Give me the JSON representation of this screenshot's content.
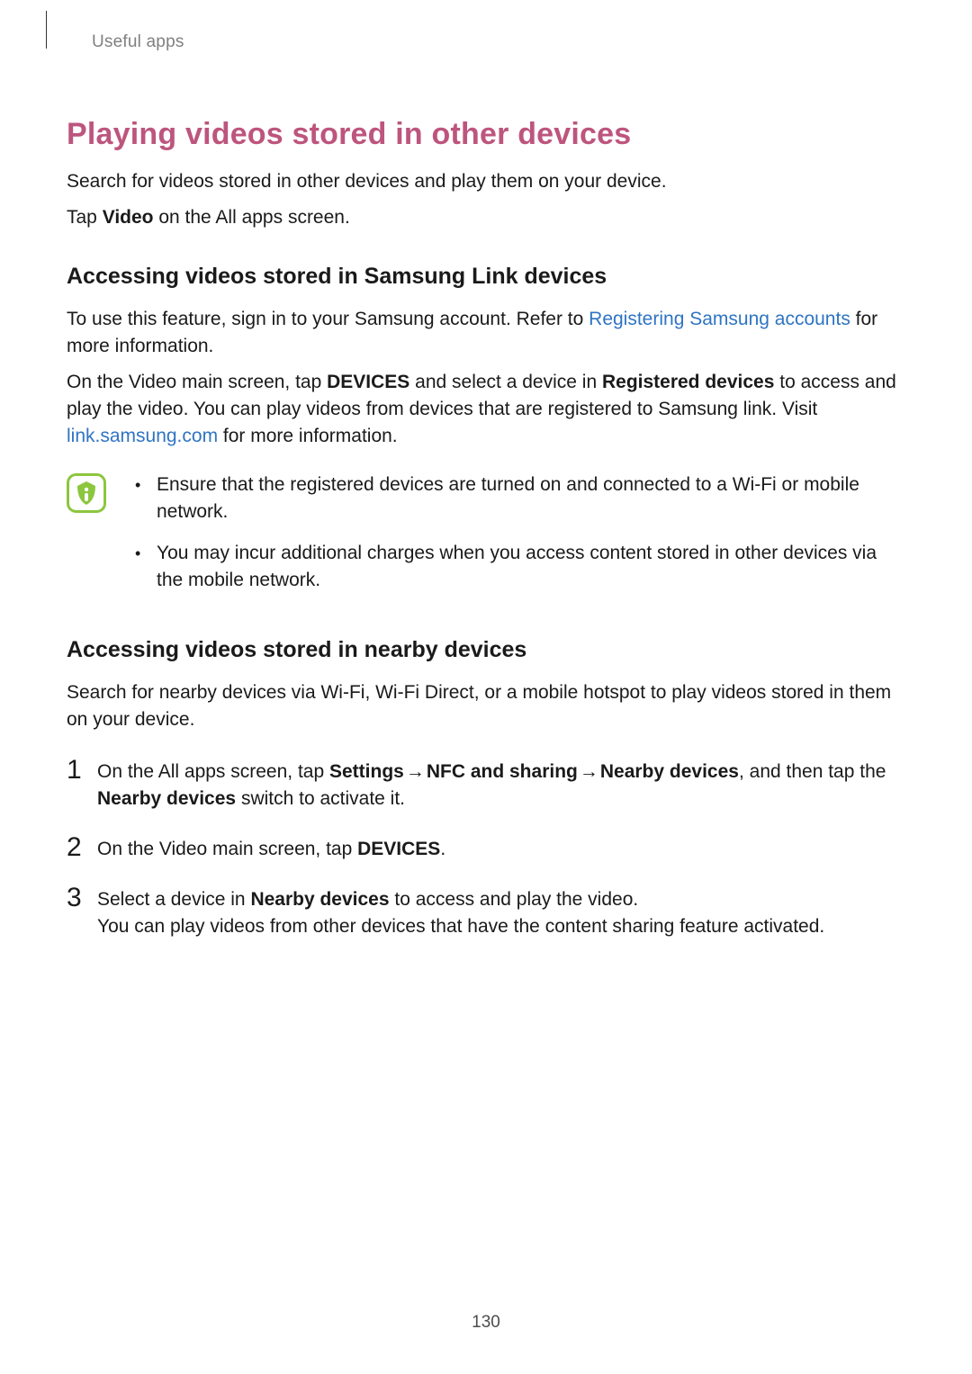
{
  "header": {
    "breadcrumb": "Useful apps"
  },
  "h1": "Playing videos stored in other devices",
  "intro_p1": "Search for videos stored in other devices and play them on your device.",
  "intro_p2_pre": "Tap ",
  "intro_p2_bold": "Video",
  "intro_p2_post": " on the All apps screen.",
  "section1": {
    "heading": "Accessing videos stored in Samsung Link devices",
    "p1_pre": "To use this feature, sign in to your Samsung account. Refer to ",
    "p1_link": "Registering Samsung accounts",
    "p1_post": " for more information.",
    "p2_a": "On the Video main screen, tap ",
    "p2_b_bold": "DEVICES",
    "p2_c": " and select a device in ",
    "p2_d_bold": "Registered devices",
    "p2_e": " to access and play the video. You can play videos from devices that are registered to Samsung link. Visit ",
    "p2_link": "link.samsung.com",
    "p2_f": " for more information.",
    "notes": [
      "Ensure that the registered devices are turned on and connected to a Wi-Fi or mobile network.",
      "You may incur additional charges when you access content stored in other devices via the mobile network."
    ]
  },
  "section2": {
    "heading": "Accessing videos stored in nearby devices",
    "p1": "Search for nearby devices via Wi-Fi, Wi-Fi Direct, or a mobile hotspot to play videos stored in them on your device.",
    "steps": {
      "s1_a": "On the All apps screen, tap ",
      "s1_b_bold": "Settings",
      "s1_arrow1": " → ",
      "s1_c_bold": "NFC and sharing",
      "s1_arrow2": " → ",
      "s1_d_bold": "Nearby devices",
      "s1_e": ", and then tap the ",
      "s1_f_bold": "Nearby devices",
      "s1_g": " switch to activate it.",
      "s2_a": "On the Video main screen, tap ",
      "s2_b_bold": "DEVICES",
      "s2_c": ".",
      "s3_a": "Select a device in ",
      "s3_b_bold": "Nearby devices",
      "s3_c": " to access and play the video.",
      "s3_p2": "You can play videos from other devices that have the content sharing feature activated."
    },
    "numbers": [
      "1",
      "2",
      "3"
    ]
  },
  "page_number": "130"
}
